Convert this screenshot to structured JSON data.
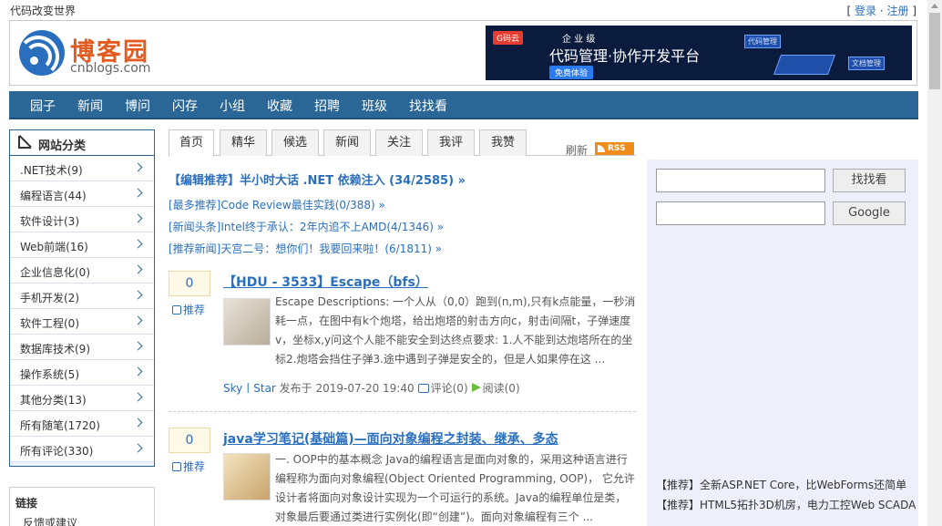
{
  "top": {
    "slogan": "代码改变世界",
    "login_open": "[ ",
    "login": "登录",
    "dot": " · ",
    "register": "注册",
    "login_close": " ]"
  },
  "logo": {
    "title": "博客园",
    "sub": "cnblogs.com"
  },
  "banner": {
    "badge": "G码云",
    "line1": "企 业 级",
    "line2": "代码管理·协作开发平台",
    "button": "免费体验",
    "card1": "代码管理",
    "card2": "文档管理"
  },
  "nav": [
    "园子",
    "新闻",
    "博问",
    "闪存",
    "小组",
    "收藏",
    "招聘",
    "班级",
    "找找看"
  ],
  "sidebar": {
    "title": "网站分类",
    "items": [
      ".NET技术(9)",
      "编程语言(44)",
      "软件设计(3)",
      "Web前端(16)",
      "企业信息化(0)",
      "手机开发(2)",
      "软件工程(0)",
      "数据库技术(9)",
      "操作系统(5)",
      "其他分类(13)",
      "所有随笔(1720)",
      "所有评论(330)"
    ]
  },
  "links": {
    "title": "链接",
    "item": "反馈或建议"
  },
  "tabs": [
    "首页",
    "精华",
    "候选",
    "新闻",
    "关注",
    "我评",
    "我赞"
  ],
  "refresh": "刷新",
  "rss": "RSS",
  "editor": "【编辑推荐】半小时大话 .NET 依赖注入 (34/2585) »",
  "headlines": [
    "[最多推荐]Code Review最佳实践(0/388) »",
    "[新闻头条]Intel终于承认：2年内追不上AMD(4/1346) »",
    "[推荐新闻]天宫二号：想你们！我要回来啦！(6/1811) »"
  ],
  "posts": [
    {
      "votes": "0",
      "rec": "推荐",
      "title": "【HDU - 3533】Escape（bfs）",
      "desc": "Escape Descriptions: 一个人从（0,0）跑到(n,m),只有k点能量，一秒消耗一点，在图中有k个炮塔，给出炮塔的射击方向c，射击间隔t，子弹速度v，坐标x,y问这个人能不能安全到达终点要求: 1.人不能到达炮塔所在的坐标2.炮塔会挡住子弹3.途中遇到子弹是安全的，但是人如果停在这 ...",
      "author": "Sky丨Star",
      "time": " 发布于 2019-07-20 19:40",
      "comment": "评论(0)",
      "read": "阅读(0)"
    },
    {
      "votes": "0",
      "rec": "推荐",
      "title": "java学习笔记(基础篇)—面向对象编程之封装、继承、多态",
      "desc": "一. OOP中的基本概念 Java的编程语言是面向对象的，采用这种语言进行编程称为面向对象编程(Object Oriented Programming, OOP)， 它允许设计者将面向对象设计实现为一个可运行的系统。Java的编程单位是类，对象最后要通过类进行实例化(即“创建”)。面向对象编程有三个 ..."
    }
  ],
  "search": {
    "btn1": "找找看",
    "btn2": "Google"
  },
  "right_ads": [
    "【推荐】全新ASP.NET Core，比WebForms还简单",
    "【推荐】HTML5拓扑3D机房，电力工控Web SCADA"
  ]
}
